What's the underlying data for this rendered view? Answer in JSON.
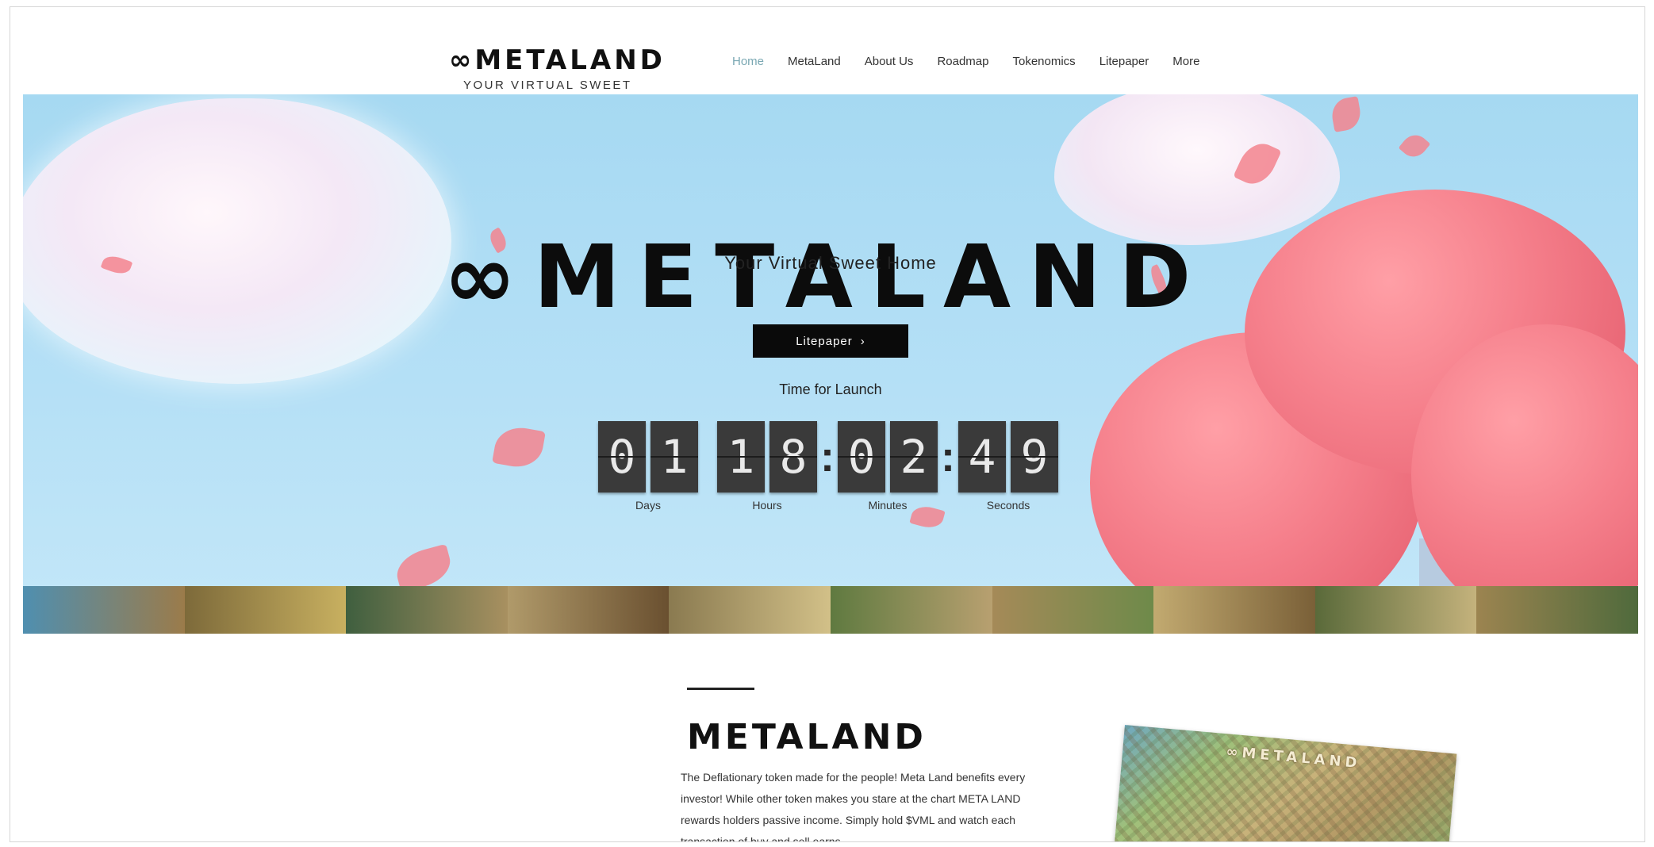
{
  "header": {
    "brand": "∞METALAND",
    "tagline": "YOUR VIRTUAL SWEET HOME",
    "nav": [
      "Home",
      "MetaLand",
      "About Us",
      "Roadmap",
      "Tokenomics",
      "Litepaper",
      "More"
    ]
  },
  "hero": {
    "title": "∞METALAND",
    "subtitle": "Your Virtual Sweet Home",
    "cta_label": "Litepaper",
    "cta_icon": "chevron-right-icon",
    "launch_label": "Time for Launch",
    "countdown": {
      "days": [
        "0",
        "1"
      ],
      "hours": [
        "1",
        "8"
      ],
      "minutes": [
        "0",
        "2"
      ],
      "seconds": [
        "4",
        "9"
      ],
      "labels": {
        "days": "Days",
        "hours": "Hours",
        "minutes": "Minutes",
        "seconds": "Seconds"
      }
    }
  },
  "section": {
    "title": "METALAND",
    "body": "The Deflationary token made for the people! Meta Land benefits every investor! While other token makes you stare at the chart META LAND rewards holders passive income. Simply hold $VML and watch each transaction of buy and sell earns",
    "map_title": "∞METALAND"
  },
  "colors": {
    "nav_active": "#7aa8b3",
    "cta_bg": "#0a0a0a",
    "sky": "#a6d9f2",
    "tree": "#f57f8b"
  }
}
